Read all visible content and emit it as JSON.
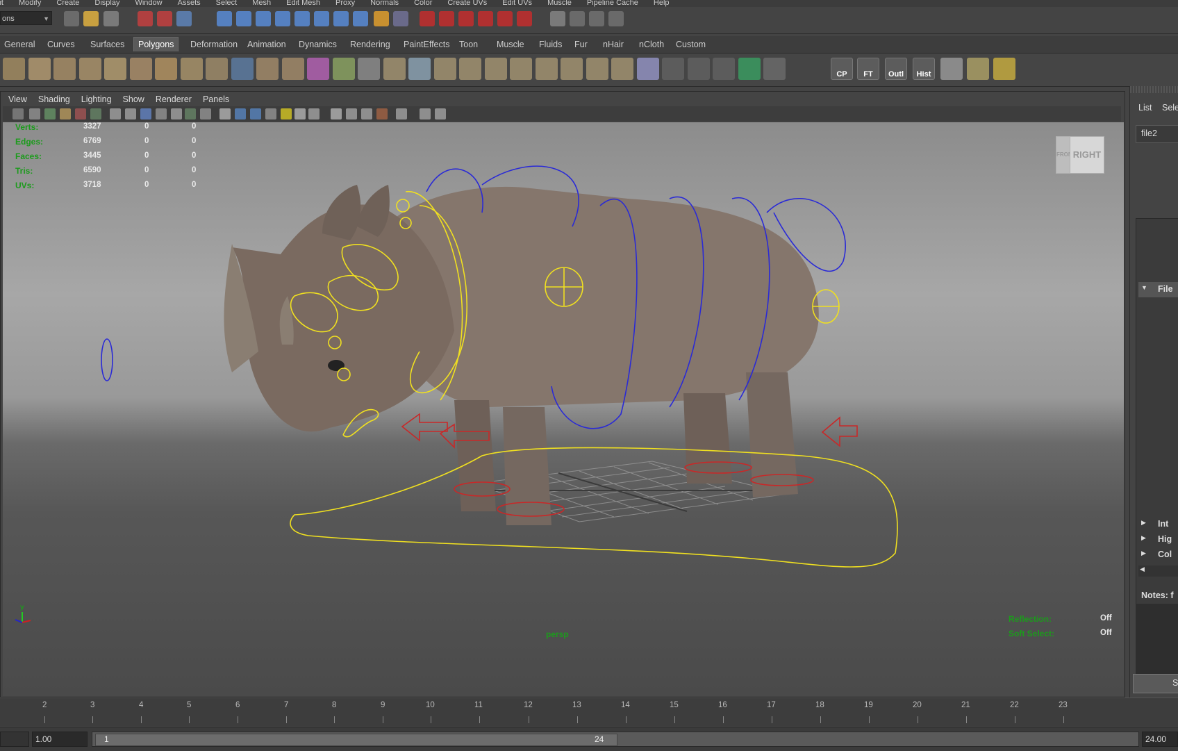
{
  "menubar": [
    "Edit",
    "Modify",
    "Create",
    "Display",
    "Window",
    "Assets",
    "Select",
    "Mesh",
    "Edit Mesh",
    "Proxy",
    "Normals",
    "Color",
    "Create UVs",
    "Edit UVs",
    "Muscle",
    "Pipeline Cache",
    "Help"
  ],
  "status": {
    "mode_selector": "ons"
  },
  "shelf_tabs": [
    {
      "label": "General"
    },
    {
      "label": "Curves"
    },
    {
      "label": "Surfaces"
    },
    {
      "label": "Polygons",
      "active": true
    },
    {
      "label": "Deformation"
    },
    {
      "label": "Animation"
    },
    {
      "label": "Dynamics"
    },
    {
      "label": "Rendering"
    },
    {
      "label": "PaintEffects"
    },
    {
      "label": "Toon"
    },
    {
      "label": "Muscle"
    },
    {
      "label": "Fluids"
    },
    {
      "label": "Fur"
    },
    {
      "label": "nHair"
    },
    {
      "label": "nCloth"
    },
    {
      "label": "Custom"
    }
  ],
  "shelf_labeled_tools": [
    "CP",
    "FT",
    "Outl",
    "Hist"
  ],
  "viewport_menu": [
    "View",
    "Shading",
    "Lighting",
    "Show",
    "Renderer",
    "Panels"
  ],
  "hud": {
    "rows": [
      {
        "label": "Verts:",
        "v1": "3327",
        "v2": "0",
        "v3": "0"
      },
      {
        "label": "Edges:",
        "v1": "6769",
        "v2": "0",
        "v3": "0"
      },
      {
        "label": "Faces:",
        "v1": "3445",
        "v2": "0",
        "v3": "0"
      },
      {
        "label": "Tris:",
        "v1": "6590",
        "v2": "0",
        "v3": "0"
      },
      {
        "label": "UVs:",
        "v1": "3718",
        "v2": "0",
        "v3": "0"
      }
    ],
    "camera": "persp",
    "reflection_label": "Reflection:",
    "reflection_value": "Off",
    "soft_select_label": "Soft Select:",
    "soft_select_value": "Off",
    "viewcube_right": "RIGHT",
    "viewcube_front": "FRONT",
    "axis_y": "y",
    "axis_x": "x"
  },
  "right_panel": {
    "tab_list": "List",
    "tab_select": "Sele",
    "node_tab": "file2",
    "section_file": "File",
    "section_int": "Int",
    "section_hig": "Hig",
    "section_col": "Col",
    "notes": "Notes: f",
    "bottom_btn": "S"
  },
  "timeline": {
    "ticks": [
      "2",
      "3",
      "4",
      "5",
      "6",
      "7",
      "8",
      "9",
      "10",
      "11",
      "12",
      "13",
      "14",
      "15",
      "16",
      "17",
      "18",
      "19",
      "20",
      "21",
      "22",
      "23"
    ]
  },
  "range": {
    "start_time": "1.00",
    "range_start": "1",
    "range_end": "24",
    "end_time": "24.00"
  },
  "colors": {
    "hud_label": "#1c9b1c",
    "curve_blue": "#2a2ad6",
    "curve_yellow": "#f0e020",
    "curve_red": "#c82828"
  }
}
